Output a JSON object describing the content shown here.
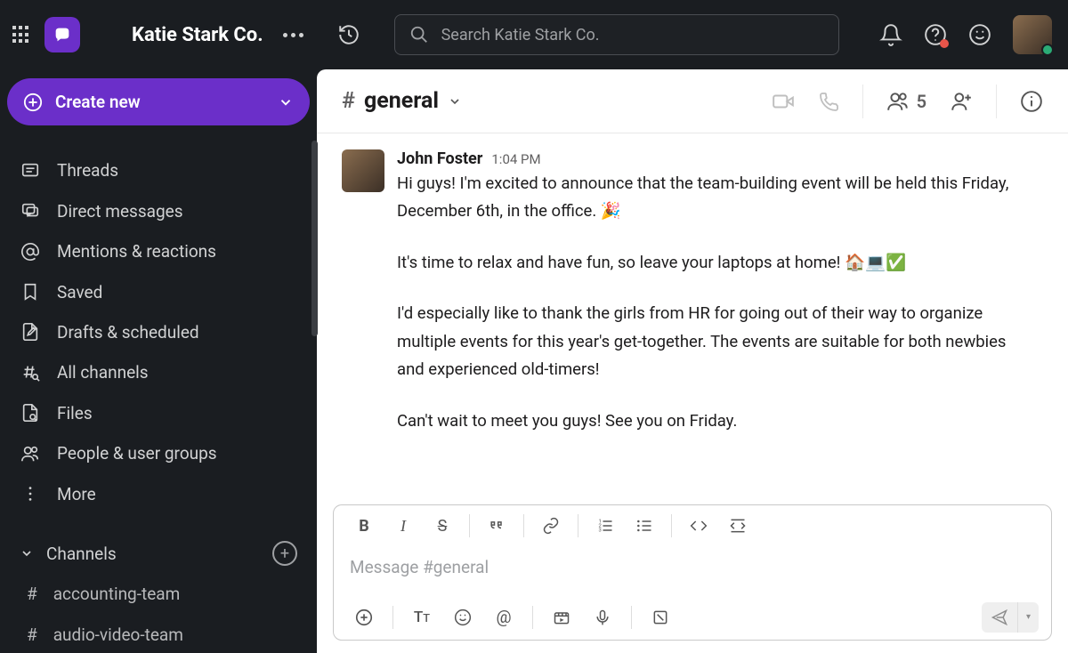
{
  "workspace": {
    "name": "Katie Stark Co."
  },
  "search": {
    "placeholder": "Search Katie Stark Co."
  },
  "sidebar": {
    "create_label": "Create new",
    "nav": [
      {
        "label": "Threads"
      },
      {
        "label": "Direct messages"
      },
      {
        "label": "Mentions & reactions"
      },
      {
        "label": "Saved"
      },
      {
        "label": "Drafts & scheduled"
      },
      {
        "label": "All channels"
      },
      {
        "label": "Files"
      },
      {
        "label": "People & user groups"
      },
      {
        "label": "More"
      }
    ],
    "channels_header": "Channels",
    "channels": [
      {
        "name": "accounting-team"
      },
      {
        "name": "audio-video-team"
      }
    ]
  },
  "channel": {
    "prefix": "#",
    "name": "general",
    "member_count": "5"
  },
  "message": {
    "author": "John Foster",
    "time": "1:04 PM",
    "p1": "Hi guys! I'm excited to announce that the team-building event will be held this Friday, December 6th, in the office. 🎉",
    "p2": "It's time to relax and have fun, so leave your laptops at home! 🏠💻✅",
    "p3": "I'd especially like to thank the girls from HR for going out of their way to organize multiple events for this year's get-together. The events are suitable for both newbies and experienced old-timers!",
    "p4": "Can't wait to meet you guys! See you on Friday."
  },
  "composer": {
    "placeholder": "Message #general"
  }
}
